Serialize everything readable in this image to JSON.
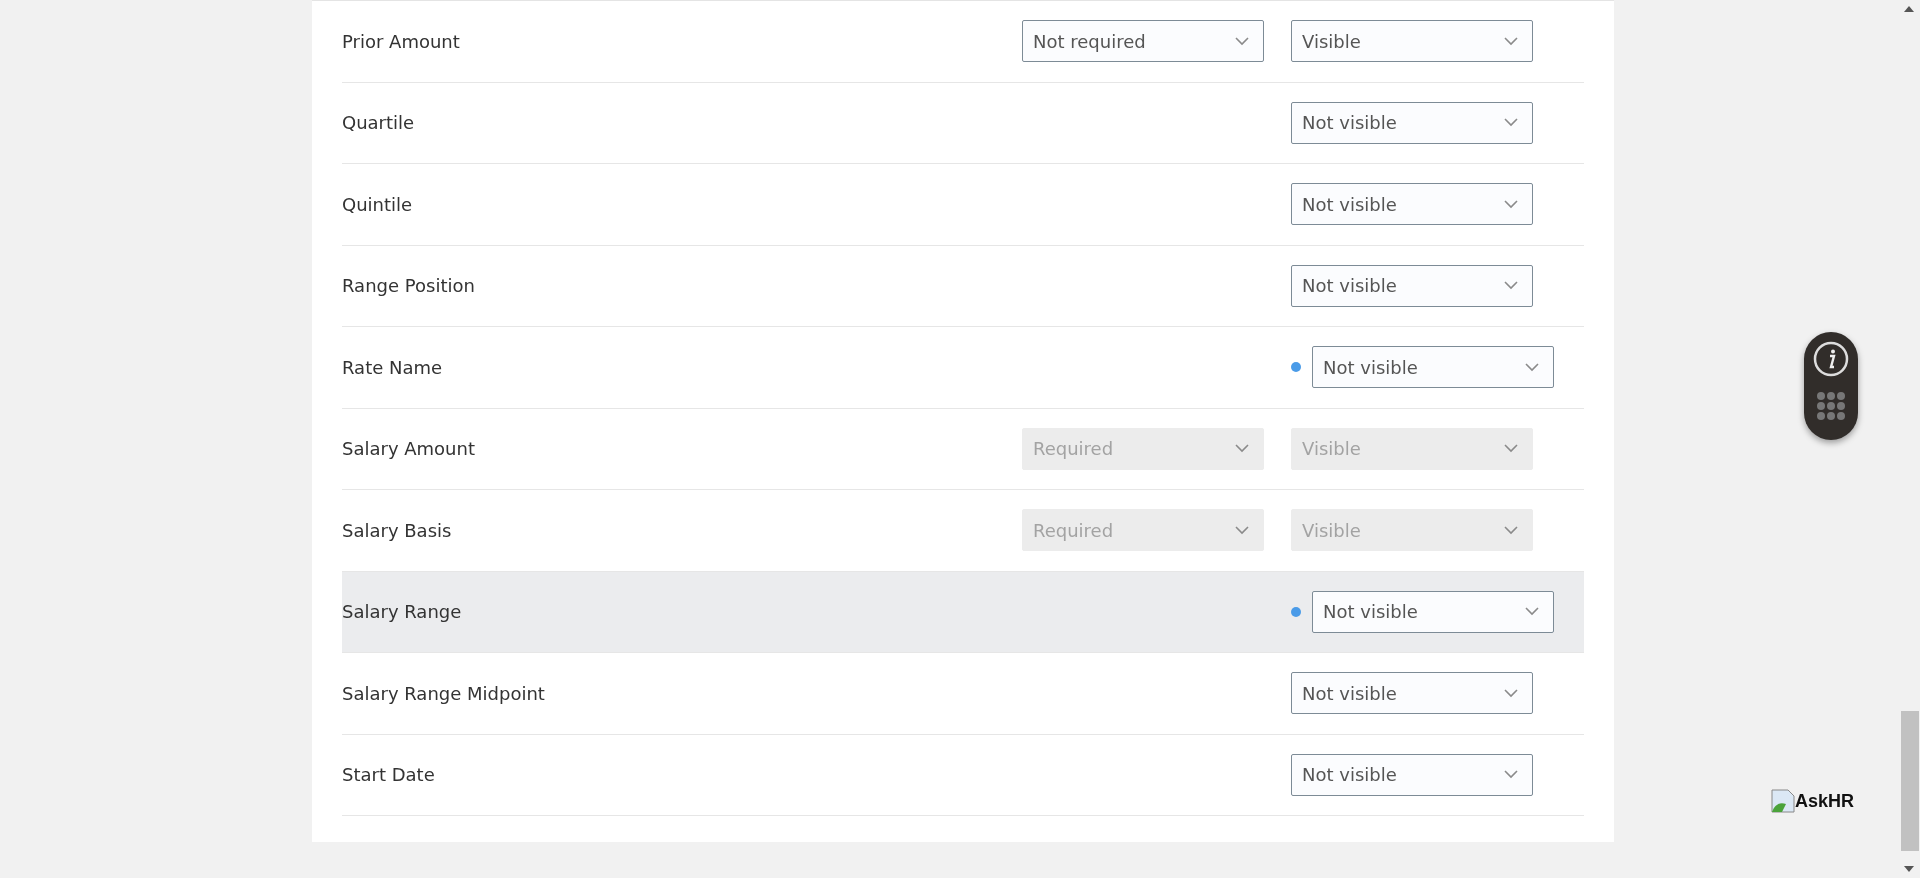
{
  "rows": [
    {
      "label": "Prior Amount",
      "selected": false,
      "changed": false,
      "requirement": {
        "value": "Not required",
        "disabled": false
      },
      "visibility": {
        "value": "Visible",
        "disabled": false
      }
    },
    {
      "label": "Quartile",
      "selected": false,
      "changed": false,
      "visibility": {
        "value": "Not visible",
        "disabled": false
      }
    },
    {
      "label": "Quintile",
      "selected": false,
      "changed": false,
      "visibility": {
        "value": "Not visible",
        "disabled": false
      }
    },
    {
      "label": "Range Position",
      "selected": false,
      "changed": false,
      "visibility": {
        "value": "Not visible",
        "disabled": false
      }
    },
    {
      "label": "Rate Name",
      "selected": false,
      "changed": true,
      "visibility": {
        "value": "Not visible",
        "disabled": false
      }
    },
    {
      "label": "Salary Amount",
      "selected": false,
      "changed": false,
      "requirement": {
        "value": "Required",
        "disabled": true
      },
      "visibility": {
        "value": "Visible",
        "disabled": true
      }
    },
    {
      "label": "Salary Basis",
      "selected": false,
      "changed": false,
      "requirement": {
        "value": "Required",
        "disabled": true
      },
      "visibility": {
        "value": "Visible",
        "disabled": true
      }
    },
    {
      "label": "Salary Range",
      "selected": true,
      "changed": true,
      "visibility": {
        "value": "Not visible",
        "disabled": false
      }
    },
    {
      "label": "Salary Range Midpoint",
      "selected": false,
      "changed": false,
      "visibility": {
        "value": "Not visible",
        "disabled": false
      }
    },
    {
      "label": "Start Date",
      "selected": false,
      "changed": false,
      "visibility": {
        "value": "Not visible",
        "disabled": false
      }
    }
  ],
  "help_link": {
    "label": "AskHR"
  }
}
